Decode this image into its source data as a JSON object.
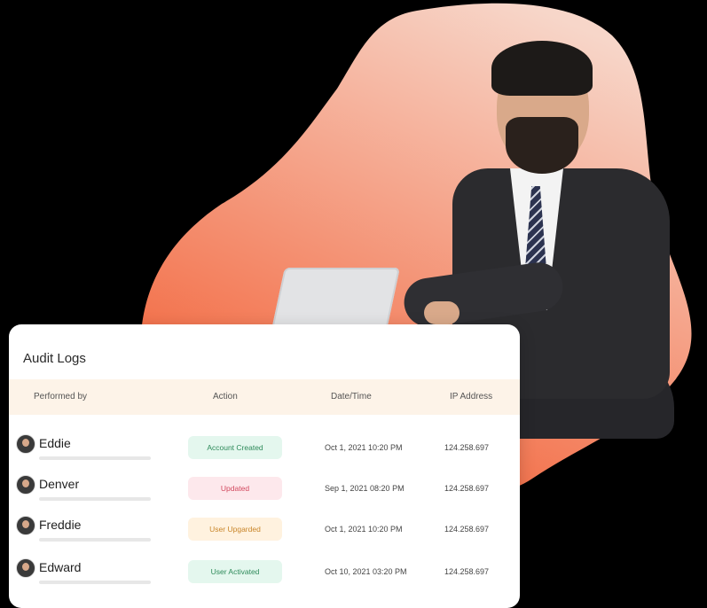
{
  "colors": {
    "background": "#000000",
    "blob_top": "#f7d6c9",
    "blob_bottom": "#f25a2e",
    "table_header_bg": "#fdf3e8"
  },
  "audit": {
    "title": "Audit Logs",
    "columns": [
      "Performed by",
      "Action",
      "Date/Time",
      "IP Address"
    ],
    "rows": [
      {
        "name": "Eddie",
        "action": "Account Created",
        "datetime": "Oct 1, 2021 10:20 PM",
        "ip": "124.258.697",
        "badge_bg": "#e4f7ee",
        "badge_color": "#2e8a5a"
      },
      {
        "name": "Denver",
        "action": "Updated",
        "datetime": "Sep 1, 2021 08:20 PM",
        "ip": "124.258.697",
        "badge_bg": "#fde8ec",
        "badge_color": "#d2485e"
      },
      {
        "name": "Freddie",
        "action": "User Upgarded",
        "datetime": "Oct 1, 2021 10:20 PM",
        "ip": "124.258.697",
        "badge_bg": "#fff2df",
        "badge_color": "#c9862a"
      },
      {
        "name": "Edward",
        "action": "User Activated",
        "datetime": "Oct 10, 2021 03:20 PM",
        "ip": "124.258.697",
        "badge_bg": "#e4f7ee",
        "badge_color": "#2e8a5a"
      }
    ]
  }
}
